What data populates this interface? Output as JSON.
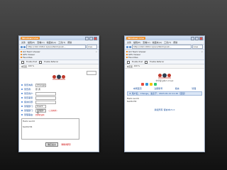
{
  "browser": {
    "app_button": "Windows Live",
    "menu": [
      "文件",
      "编辑(E)",
      "查看(V)",
      "收藏夹(A)",
      "工具(T)",
      "帮助"
    ],
    "address": "http://192.168.0.1/pwn/fetch/post...",
    "address_extra": "Live",
    "tabs": [
      {
        "label": "GO Team Viewer"
      },
      {
        "label": "GPS Viewer"
      },
      {
        "label": "Favorites"
      }
    ],
    "status_items": [
      "Enable Post",
      "Enable Referrer"
    ],
    "toolbar_items": [
      "本页面",
      "100 %"
    ]
  },
  "left_page": {
    "fields": [
      {
        "label": "受查询者:",
        "value": "Change",
        "hint": ""
      },
      {
        "label": "受查者:",
        "value": "张 勇",
        "hint": ""
      },
      {
        "label": "受查用户:",
        "value": "",
        "hint": ""
      },
      {
        "label": "受查事项:",
        "value": "",
        "hint": ""
      },
      {
        "label": "留言标题:",
        "value": "",
        "hint": ""
      },
      {
        "label": "受理部门:",
        "value": "User1",
        "hint": ""
      },
      {
        "label": "受理部门:",
        "value": "受理部门名",
        "hint": "（上传附件）"
      },
      {
        "label": "受理事由:",
        "value": "回复验证码",
        "hint": ""
      }
    ],
    "textarea": "Hello world\n\ntest1234",
    "submit_label": "确定提交",
    "reset_label": "（重新填写）"
  },
  "right_page": {
    "logo_caption": "中华留言本V1.0 test",
    "nav_items": [
      "本网首页",
      "注册账号",
      "留言",
      "管理"
    ],
    "bar_text": "★ 用户名：Change，发表于：2023-01-10 11:20（回复）",
    "post_line1": "Hello world",
    "post_line2": "test1234",
    "footer": "版权所有 留言本V1.0"
  }
}
